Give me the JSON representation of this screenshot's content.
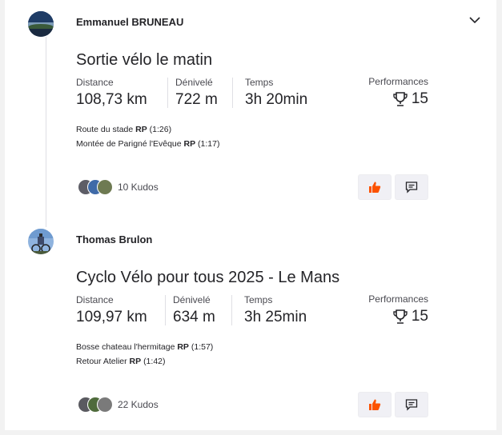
{
  "colors": {
    "accent": "#fc5200",
    "text": "#242428",
    "muted": "#494950",
    "button_bg": "#f0f0f5"
  },
  "activities": [
    {
      "athlete": "Emmanuel BRUNEAU",
      "title": "Sortie vélo le matin",
      "stats": [
        {
          "label": "Distance",
          "value": "108,73 km"
        },
        {
          "label": "Dénivelé",
          "value": "722 m"
        },
        {
          "label": "Temps",
          "value": "3h 20min"
        }
      ],
      "performances": {
        "label": "Performances",
        "value": "15",
        "icon": "trophy-icon"
      },
      "segments": [
        {
          "name": "Route du stade",
          "badge": "RP",
          "time": "(1:26)"
        },
        {
          "name": "Montée de Parigné l'Evêque",
          "badge": "RP",
          "time": "(1:17)"
        }
      ],
      "kudos_label": "10 Kudos",
      "has_menu": true
    },
    {
      "athlete": "Thomas Brulon",
      "title": "Cyclo Vélo pour tous 2025 - Le Mans",
      "stats": [
        {
          "label": "Distance",
          "value": "109,97 km"
        },
        {
          "label": "Dénivelé",
          "value": "634 m"
        },
        {
          "label": "Temps",
          "value": "3h 25min"
        }
      ],
      "performances": {
        "label": "Performances",
        "value": "15",
        "icon": "trophy-icon"
      },
      "segments": [
        {
          "name": "Bosse chateau l'hermitage",
          "badge": "RP",
          "time": "(1:57)"
        },
        {
          "name": "Retour Atelier",
          "badge": "RP",
          "time": "(1:42)"
        }
      ],
      "kudos_label": "22 Kudos",
      "has_menu": false
    }
  ]
}
